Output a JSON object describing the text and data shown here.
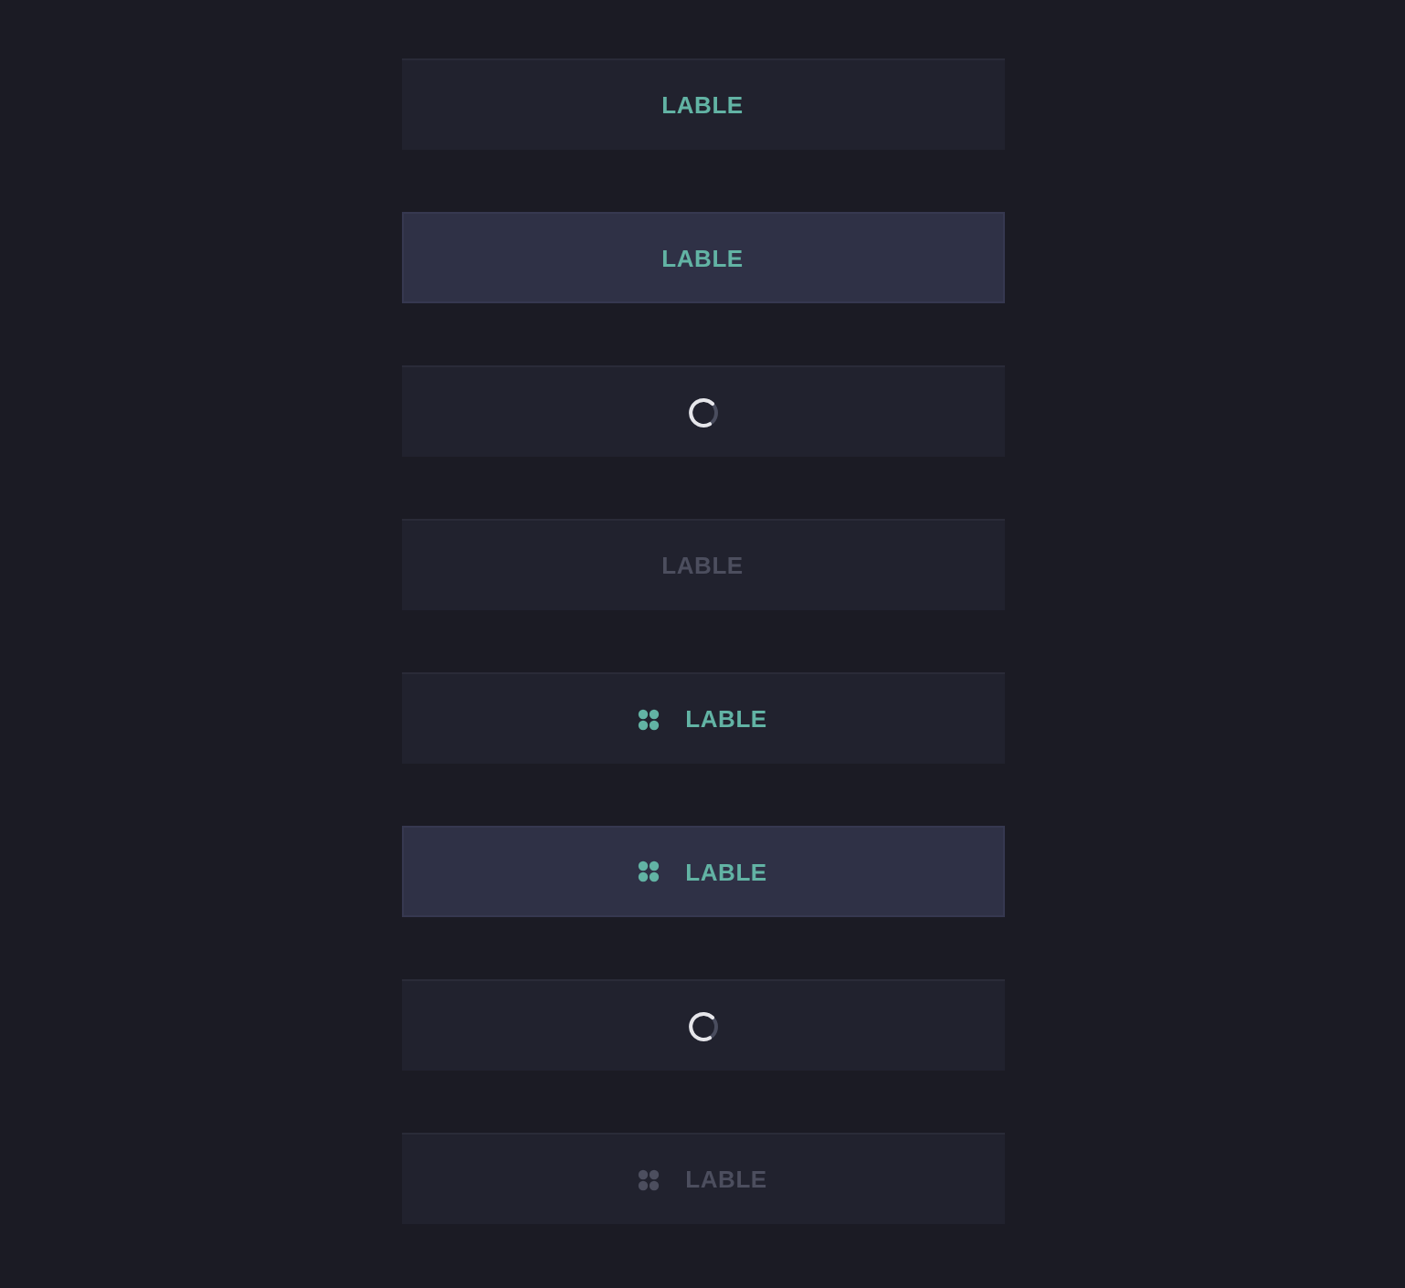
{
  "buttons": [
    {
      "label": "LABLE",
      "hovered": false,
      "disabled": false,
      "loading": false,
      "icon": false
    },
    {
      "label": "LABLE",
      "hovered": true,
      "disabled": false,
      "loading": false,
      "icon": false
    },
    {
      "hovered": false,
      "disabled": false,
      "loading": true
    },
    {
      "label": "LABLE",
      "hovered": false,
      "disabled": true,
      "loading": false,
      "icon": false
    },
    {
      "label": "LABLE",
      "hovered": false,
      "disabled": false,
      "loading": false,
      "icon": true
    },
    {
      "label": "LABLE",
      "hovered": true,
      "disabled": false,
      "loading": false,
      "icon": true
    },
    {
      "hovered": false,
      "disabled": false,
      "loading": true
    },
    {
      "label": "LABLE",
      "hovered": false,
      "disabled": true,
      "loading": false,
      "icon": true
    }
  ]
}
